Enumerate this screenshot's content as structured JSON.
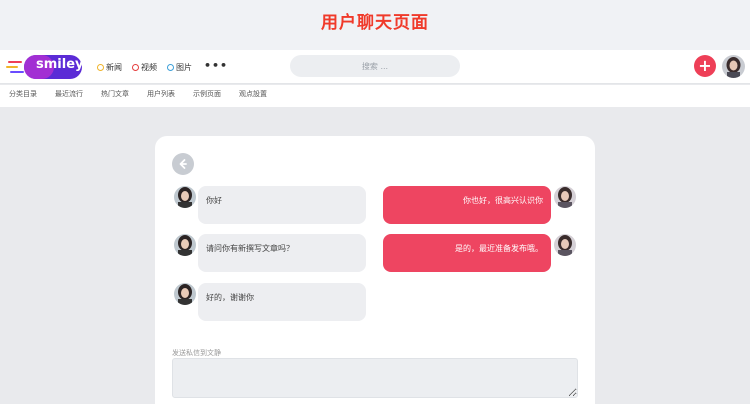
{
  "page_title": "用户聊天页面",
  "header": {
    "logo_text": "smiley",
    "nav": [
      {
        "label": "新闻",
        "color": "#f0b429"
      },
      {
        "label": "视频",
        "color": "#e53e3e"
      },
      {
        "label": "图片",
        "color": "#3b9fd8"
      }
    ],
    "more_label": "•••",
    "search_placeholder": "搜索 ...",
    "plus_label": "+"
  },
  "subnav": [
    "分类目录",
    "最近流行",
    "热门文章",
    "用户列表",
    "示例页面",
    "观点設置"
  ],
  "chat": {
    "messages": [
      {
        "side": "left",
        "text": "你好"
      },
      {
        "side": "right",
        "text": "你也好，很高兴认识你"
      },
      {
        "side": "left",
        "text": "请问你有新撰写文章吗？"
      },
      {
        "side": "right",
        "text": "是的，最近准备发布哦。"
      },
      {
        "side": "left",
        "text": "好的，谢谢你"
      }
    ],
    "form_label": "发送私信到文静"
  },
  "colors": {
    "accent": "#ee4561",
    "title": "#f03a2a"
  }
}
